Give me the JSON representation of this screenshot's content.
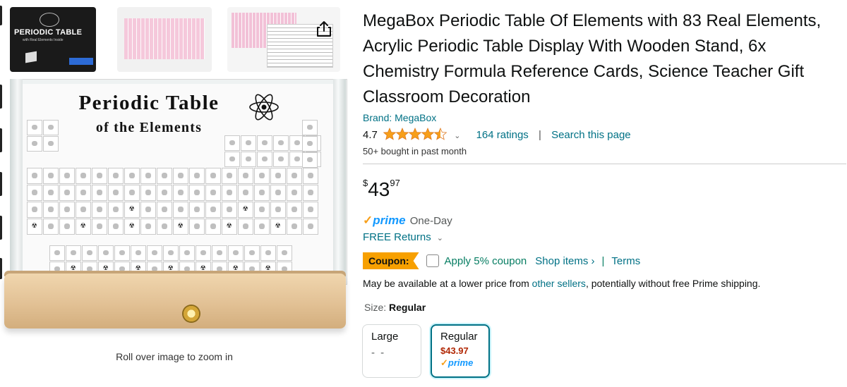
{
  "product": {
    "title": "MegaBox Periodic Table Of Elements with 83 Real Elements, Acrylic Periodic Table Display With Wooden Stand, 6x Chemistry Formula Reference Cards, Science Teacher Gift Classroom Decoration",
    "brand": "Brand: MegaBox",
    "rating_value": "4.7",
    "rating_stars": 4.5,
    "ratings_count": "164 ratings",
    "search_link": "Search this page",
    "bought": "50+ bought in past month"
  },
  "price": {
    "symbol": "$",
    "whole": "43",
    "fraction": "97"
  },
  "delivery": {
    "prime_check": "✓",
    "prime": "prime",
    "tier": "One-Day",
    "returns": "FREE Returns"
  },
  "coupon": {
    "badge": "Coupon:",
    "apply": "Apply 5% coupon",
    "shop": "Shop items ›",
    "separator": "|",
    "terms": "Terms"
  },
  "sellers": {
    "prefix": "May be available at a lower price from ",
    "link": "other sellers",
    "suffix": ", potentially without free Prime shipping."
  },
  "size": {
    "label": "Size:",
    "selected": "Regular",
    "options": [
      {
        "name": "Large",
        "price": "- -"
      },
      {
        "name": "Regular",
        "price": "$43.97",
        "prime": "prime"
      }
    ]
  },
  "gallery": {
    "box_title": "PERIODIC TABLE",
    "box_subtitle": "with Real Elements Inside",
    "image_title": "Periodic Table",
    "image_subtitle": "of the Elements",
    "zoom_hint": "Roll over image to zoom in"
  },
  "colors": {
    "link": "#007185",
    "coupon": "#f7a000",
    "price_red": "#b12704",
    "star": "#f79f1a",
    "prime": "#1399ff"
  },
  "icons": [
    "share-icon",
    "atom-icon",
    "star-icon",
    "chevron-down-icon",
    "prime-check-icon",
    "checkbox-icon"
  ]
}
